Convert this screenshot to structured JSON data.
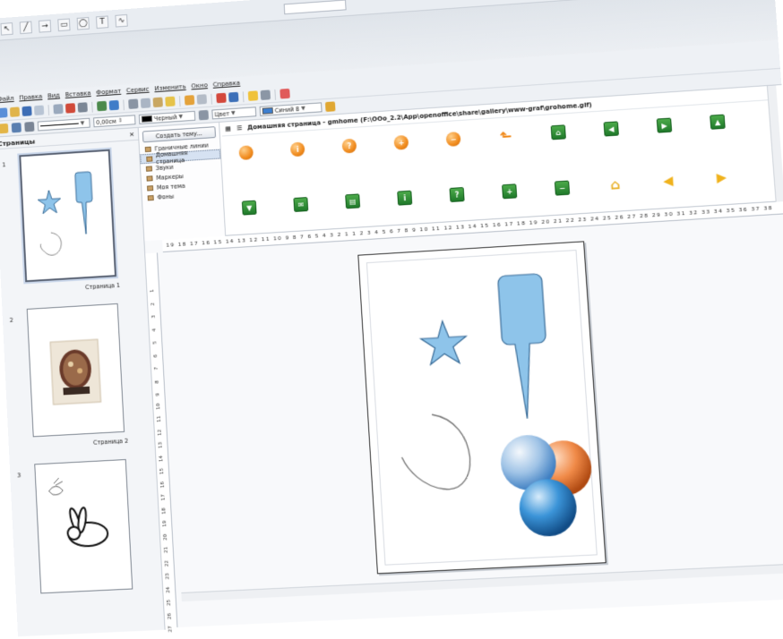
{
  "menu": [
    "Файл",
    "Правка",
    "Вид",
    "Вставка",
    "Формат",
    "Сервис",
    "Изменить",
    "Окно",
    "Справка"
  ],
  "toolbar2": {
    "line_width": "0,00см",
    "line_color": "Черный",
    "area_style": "Цвет",
    "area_color": "Синий 8"
  },
  "colors": {
    "line_color_swatch": "#000000",
    "area_color_swatch": "#3d7fd0",
    "shape_fill": "#8ec4ea",
    "shape_stroke": "#3a6d99"
  },
  "pages_panel": {
    "title": "Страницы",
    "pages": [
      {
        "number": "1",
        "label": "Страница 1"
      },
      {
        "number": "2",
        "label": "Страница 2"
      },
      {
        "number": "3",
        "label": ""
      }
    ]
  },
  "gallery": {
    "new_theme_button": "Создать тему...",
    "themes": [
      "Граничные линии",
      "Домашняя страница",
      "Звуки",
      "Маркеры",
      "Моя тема",
      "Фоны"
    ],
    "selected_theme": "Домашняя страница",
    "header": "Домашняя страница - gmhome (F:\\OOo_2.2\\App\\openoffice\\share\\gallery\\www-graf\\grohome.gif)",
    "row1_icons": [
      "orange-ball-icon",
      "info-ball-icon",
      "help-ball-icon",
      "plus-ball-icon",
      "minus-ball-icon",
      "back-arrow-icon",
      "home-square-icon",
      "left-square-icon",
      "right-square-icon",
      "up-square-icon"
    ],
    "row2_icons": [
      "down-square-icon",
      "mail-square-icon",
      "save-square-icon",
      "info-square-icon",
      "help-square-icon",
      "plus-square-icon",
      "minus-square-icon",
      "house-icon",
      "left-arrow-icon",
      "right-arrow-icon"
    ]
  },
  "rulers": {
    "horizontal": "19 18 17 16 15 14 13 12 11 10 9 8 7 6 5 4 3 2 1   1 2 3 4 5 6 7 8 9 10 11 12 13 14 15 16 17 18 19 20 21 22 23 24 25 26 27 28 29 30 31 32 33 34 35 36 37 38",
    "vertical": [
      "1",
      "2",
      "3",
      "4",
      "5",
      "6",
      "7",
      "8",
      "9",
      "10",
      "11",
      "12",
      "13",
      "14",
      "15",
      "16",
      "17",
      "18",
      "19",
      "20",
      "21",
      "22",
      "23",
      "24",
      "25",
      "26",
      "27"
    ]
  }
}
